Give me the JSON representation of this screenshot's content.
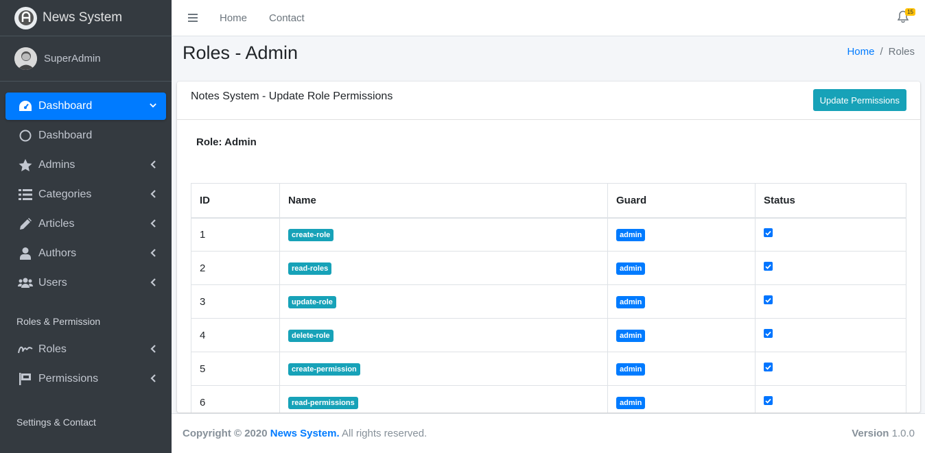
{
  "brand": {
    "name": "News System"
  },
  "user": {
    "name": "SuperAdmin"
  },
  "sidebar": {
    "items": [
      {
        "label": "Dashboard",
        "icon": "tachometer-icon",
        "active": true
      },
      {
        "label": "Dashboard",
        "icon": "circle-icon"
      },
      {
        "label": "Admins",
        "icon": "star-icon"
      },
      {
        "label": "Categories",
        "icon": "list-icon"
      },
      {
        "label": "Articles",
        "icon": "pencil-icon"
      },
      {
        "label": "Authors",
        "icon": "user-icon"
      },
      {
        "label": "Users",
        "icon": "users-icon"
      }
    ],
    "section_roles": "Roles & Permission",
    "roles_items": [
      {
        "label": "Roles",
        "icon": "signature-icon"
      },
      {
        "label": "Permissions",
        "icon": "flag-icon"
      }
    ],
    "section_settings": "Settings & Contact"
  },
  "topbar": {
    "home": "Home",
    "contact": "Contact",
    "notifications_count": "15"
  },
  "header": {
    "title": "Roles - Admin",
    "breadcrumb_home": "Home",
    "breadcrumb_sep": "/",
    "breadcrumb_current": "Roles"
  },
  "card": {
    "title": "Notes System - Update Role Permissions",
    "button": "Update Permissions",
    "role_label": "Role: Admin"
  },
  "table": {
    "columns": [
      "ID",
      "Name",
      "Guard",
      "Status"
    ],
    "rows": [
      {
        "id": "1",
        "name": "create-role",
        "guard": "admin",
        "checked": true
      },
      {
        "id": "2",
        "name": "read-roles",
        "guard": "admin",
        "checked": true
      },
      {
        "id": "3",
        "name": "update-role",
        "guard": "admin",
        "checked": true
      },
      {
        "id": "4",
        "name": "delete-role",
        "guard": "admin",
        "checked": true
      },
      {
        "id": "5",
        "name": "create-permission",
        "guard": "admin",
        "checked": true
      },
      {
        "id": "6",
        "name": "read-permissions",
        "guard": "admin",
        "checked": true
      }
    ]
  },
  "footer": {
    "copyright": "Copyright © 2020",
    "brand": "News System.",
    "rights": "All rights reserved.",
    "version_label": "Version",
    "version": "1.0.0"
  },
  "colors": {
    "sidebar": "#343a40",
    "primary": "#007bff",
    "info": "#17a2b8",
    "warning": "#ffc107"
  }
}
